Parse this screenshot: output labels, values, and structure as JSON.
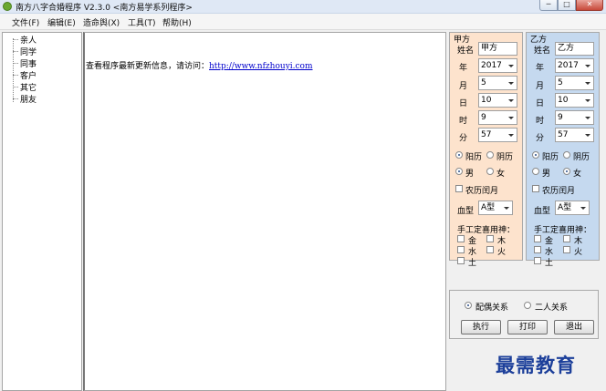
{
  "window": {
    "title": "南方八字合婚程序 V2.3.0  <南方易学系列程序>",
    "controls": {
      "minimize": "─",
      "maximize": "□",
      "close": "✕"
    }
  },
  "menu": [
    "文件(F)",
    "编辑(E)",
    "造命舆(X)",
    "工具(T)",
    "帮助(H)"
  ],
  "tree": [
    "亲人",
    "同学",
    "同事",
    "客户",
    "其它",
    "朋友"
  ],
  "content": {
    "message": "查看程序最新更新信息，请访问：",
    "link": "http://www.nfzhouyi.com"
  },
  "party_a": {
    "title": "甲方",
    "name_label": "姓名",
    "name_value": "甲方",
    "year_label": "年",
    "year": "2017",
    "month_label": "月",
    "month": "5",
    "day_label": "日",
    "day": "10",
    "hour_label": "时",
    "hour": "9",
    "minute_label": "分",
    "minute": "57",
    "calendar_solar": "阳历",
    "calendar_lunar": "阴历",
    "calendar_selected": "阳历",
    "gender_male": "男",
    "gender_female": "女",
    "gender_selected": "男",
    "leap_label": "农历闰月",
    "blood_label": "血型",
    "blood": "A型",
    "yongshen_label": "手工定喜用神：",
    "elements": [
      "金",
      "木",
      "水",
      "火",
      "土"
    ]
  },
  "party_b": {
    "title": "乙方",
    "name_label": "姓名",
    "name_value": "乙方",
    "year_label": "年",
    "year": "2017",
    "month_label": "月",
    "month": "5",
    "day_label": "日",
    "day": "10",
    "hour_label": "时",
    "hour": "9",
    "minute_label": "分",
    "minute": "57",
    "calendar_solar": "阳历",
    "calendar_lunar": "阴历",
    "calendar_selected": "阳历",
    "gender_male": "男",
    "gender_female": "女",
    "gender_selected": "女",
    "leap_label": "农历闰月",
    "blood_label": "血型",
    "blood": "A型",
    "yongshen_label": "手工定喜用神：",
    "elements": [
      "金",
      "木",
      "水",
      "火",
      "土"
    ]
  },
  "relation": {
    "spouse_label": "配偶关系",
    "pair_label": "二人关系",
    "selected": "配偶关系"
  },
  "actions": {
    "execute": "执行",
    "print": "打印",
    "exit": "退出"
  },
  "watermark": "最需教育"
}
